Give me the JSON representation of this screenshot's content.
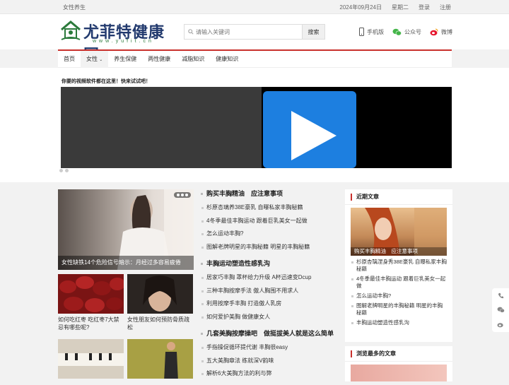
{
  "topbar": {
    "left": "女性养生",
    "date": "2024年09月24日",
    "weekday": "星期二",
    "login": "登录",
    "register": "注册"
  },
  "header": {
    "logo_cn": "尤菲特健康网",
    "logo_en": "www.yufit.cn",
    "search_placeholder": "请输入关键词",
    "search_button": "搜索",
    "links": {
      "mobile": "手机版",
      "wechat": "公众号",
      "weibo": "微博"
    }
  },
  "nav": {
    "items": [
      "首页",
      "女性",
      "养生保健",
      "两性健康",
      "减脂知识",
      "健康知识"
    ]
  },
  "banner": {
    "ad_text": "你要的视频软件都在这里！快来试试吧！"
  },
  "left": {
    "feature_caption": "女性缺铁14个危险信号暗示：月经过多容易疲倦",
    "tiles": [
      {
        "caption": "如何吃红枣 吃红枣7大禁忌有哪些呢?"
      },
      {
        "caption": "女性朋友如何预防骨质疏松"
      }
    ]
  },
  "middle": {
    "sections": [
      {
        "title": "购买丰胸精油　应注意事项",
        "items": [
          "杉原杏璃养38E豪乳 自曝私家丰胸秘籍",
          "4冬季最佳丰胸运动 跟着巨乳美女一起做",
          "怎么运动丰胸?",
          "图解老牌明星的丰胸秘籍 明星的丰胸秘籍"
        ]
      },
      {
        "title": "丰胸运动塑造性感乳沟",
        "items": [
          "居家巧丰胸 罩杯给力升级 A杯迅速变Dcup",
          "三种丰胸按摩手法 傲人胸围不用求人",
          "利用按摩手丰胸 打造傲人乳房",
          "如何爱护美胸 做健康女人"
        ]
      },
      {
        "title": "几套美胸按摩操吧　做挺拔美人就是这么简单",
        "items": [
          "手指操促循环提代谢 丰胸很easy",
          "五大美胸章法 练就深V韵味",
          "解析6大美胸方法的利与弊"
        ]
      }
    ]
  },
  "sidebar": {
    "recent": {
      "title": "近期文章",
      "pic_caption": "购买丰胸精油　应注意事项",
      "items": [
        "杉原杏璃涅身秀38E豪乳 自曝私家丰胸秘籍",
        "4冬季最佳丰胸运动 跟着巨乳美女一起做",
        "怎么运动丰胸?",
        "图解老牌明星的丰胸秘籍 明星的丰胸秘籍",
        "丰胸运动塑造性感乳沟"
      ]
    },
    "popular": {
      "title": "浏览最多的文章"
    }
  },
  "colors": {
    "accent": "#c9302c",
    "video_play": "#1d7fe0"
  }
}
